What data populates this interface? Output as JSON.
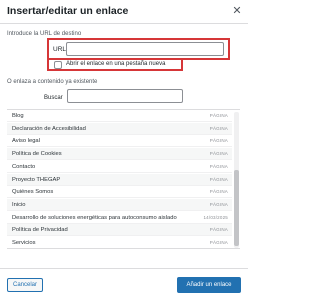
{
  "dialog": {
    "title": "Insertar/editar un enlace",
    "close_icon": "close-icon"
  },
  "link_form": {
    "instructions": "Introduce la URL de destino",
    "url_label": "URL",
    "url_value": "",
    "new_tab_label": "Abrir el enlace en una pestaña nueva",
    "new_tab_checked": false
  },
  "existing": {
    "heading": "O enlaza a contenido ya existente",
    "search_label": "Buscar",
    "search_value": ""
  },
  "results": [
    {
      "title": "Blog",
      "type": "PÁGINA"
    },
    {
      "title": "Declaración de Accesibilidad",
      "type": "PÁGINA"
    },
    {
      "title": "Aviso legal",
      "type": "PÁGINA"
    },
    {
      "title": "Política de Cookies",
      "type": "PÁGINA"
    },
    {
      "title": "Contacto",
      "type": "PÁGINA"
    },
    {
      "title": "Proyecto THEGAP",
      "type": "PÁGINA"
    },
    {
      "title": "Quiénes Somos",
      "type": "PÁGINA"
    },
    {
      "title": "Inicio",
      "type": "PÁGINA"
    },
    {
      "title": "Desarrollo de soluciones energéticas para autoconsumo aislado",
      "type": "14/03/2025"
    },
    {
      "title": "Política de Privacidad",
      "type": "PÁGINA"
    },
    {
      "title": "Servicios",
      "type": "PÁGINA"
    }
  ],
  "footer": {
    "cancel_label": "Cancelar",
    "submit_label": "Añadir un enlace"
  },
  "colors": {
    "highlight_border": "#d63638",
    "primary": "#2271b1"
  }
}
